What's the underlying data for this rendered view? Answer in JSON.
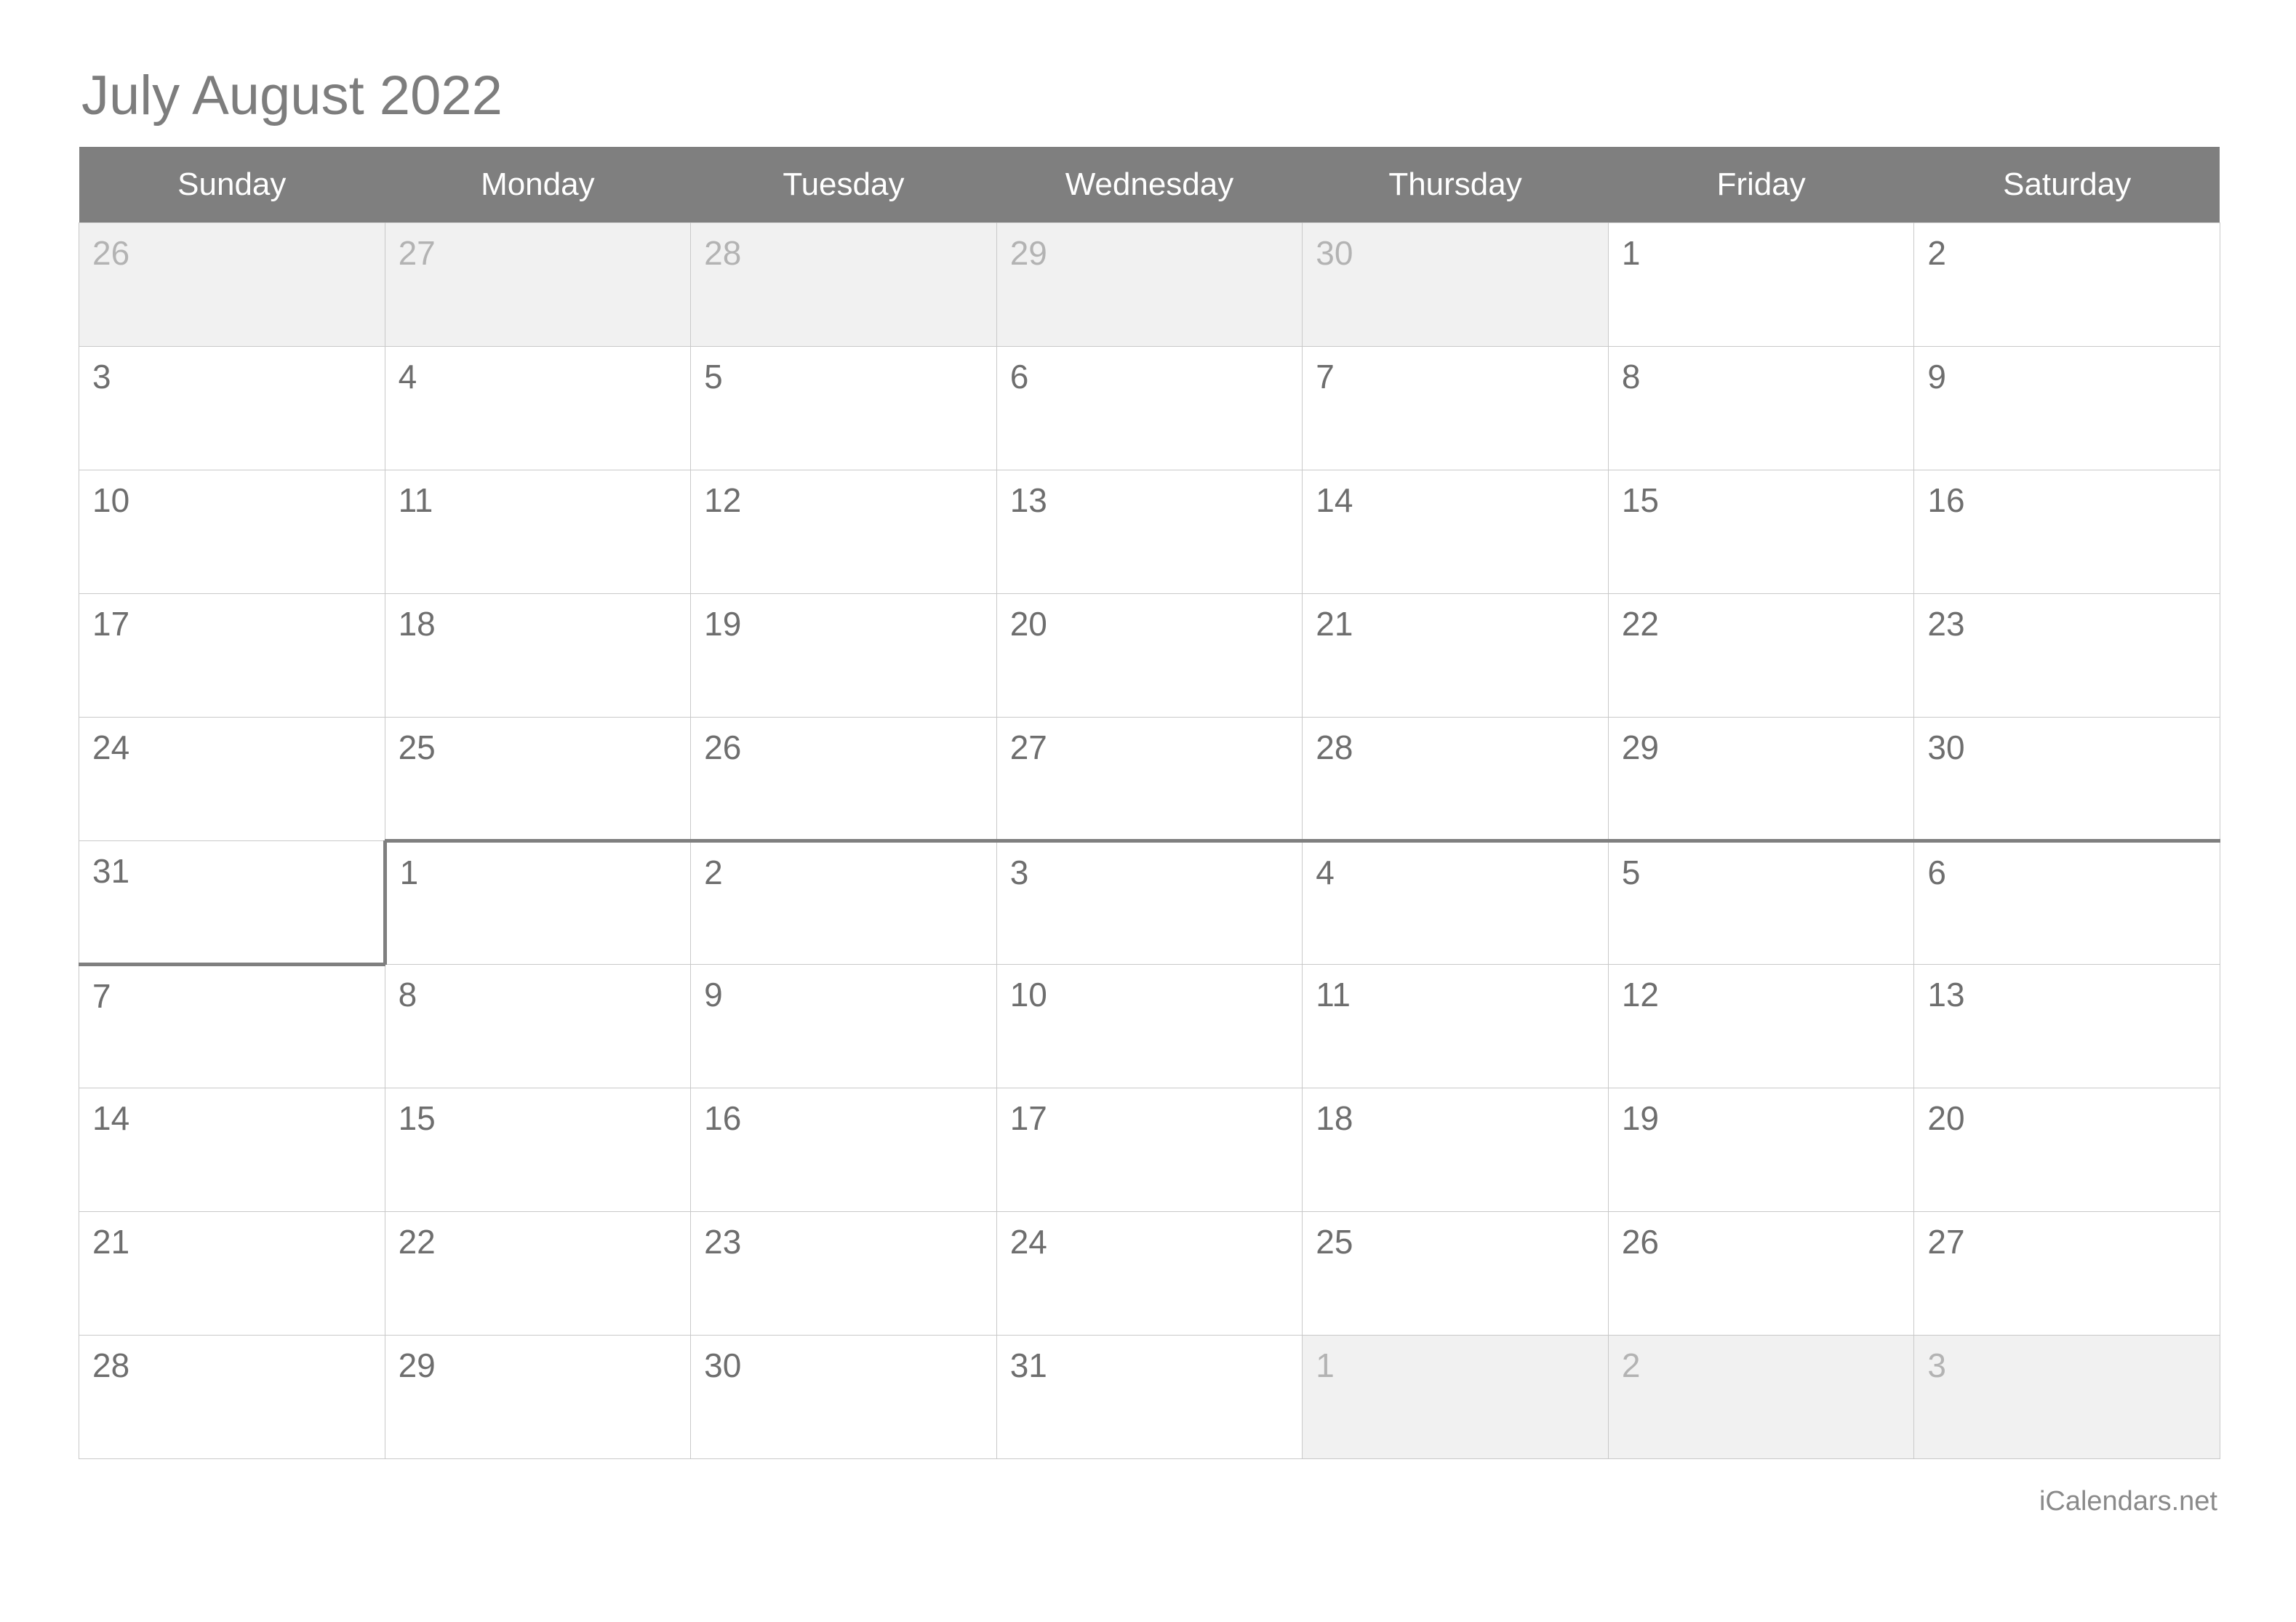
{
  "title": "July August 2022",
  "brand": "iCalendars.net",
  "colors": {
    "header_bg": "#7f7f7f",
    "header_text": "#ffffff",
    "title_text": "#7d7d7d",
    "day_text": "#6e6e6e",
    "muted_text": "#b3b3b3",
    "muted_bg": "#f1f1f1",
    "grid_line": "#c9c9c9",
    "month_divider": "#7f7f7f",
    "cell_bg": "#ffffff"
  },
  "weekdays": [
    {
      "label": "Sunday"
    },
    {
      "label": "Monday"
    },
    {
      "label": "Tuesday"
    },
    {
      "label": "Wednesday"
    },
    {
      "label": "Thursday"
    },
    {
      "label": "Friday"
    },
    {
      "label": "Saturday"
    }
  ],
  "weeks": [
    {
      "cells": [
        {
          "num": "26",
          "muted": true
        },
        {
          "num": "27",
          "muted": true
        },
        {
          "num": "28",
          "muted": true
        },
        {
          "num": "29",
          "muted": true
        },
        {
          "num": "30",
          "muted": true
        },
        {
          "num": "1",
          "muted": false
        },
        {
          "num": "2",
          "muted": false
        }
      ]
    },
    {
      "cells": [
        {
          "num": "3",
          "muted": false
        },
        {
          "num": "4",
          "muted": false
        },
        {
          "num": "5",
          "muted": false
        },
        {
          "num": "6",
          "muted": false
        },
        {
          "num": "7",
          "muted": false
        },
        {
          "num": "8",
          "muted": false
        },
        {
          "num": "9",
          "muted": false
        }
      ]
    },
    {
      "cells": [
        {
          "num": "10",
          "muted": false
        },
        {
          "num": "11",
          "muted": false
        },
        {
          "num": "12",
          "muted": false
        },
        {
          "num": "13",
          "muted": false
        },
        {
          "num": "14",
          "muted": false
        },
        {
          "num": "15",
          "muted": false
        },
        {
          "num": "16",
          "muted": false
        }
      ]
    },
    {
      "cells": [
        {
          "num": "17",
          "muted": false
        },
        {
          "num": "18",
          "muted": false
        },
        {
          "num": "19",
          "muted": false
        },
        {
          "num": "20",
          "muted": false
        },
        {
          "num": "21",
          "muted": false
        },
        {
          "num": "22",
          "muted": false
        },
        {
          "num": "23",
          "muted": false
        }
      ]
    },
    {
      "cells": [
        {
          "num": "24",
          "muted": false
        },
        {
          "num": "25",
          "muted": false
        },
        {
          "num": "26",
          "muted": false
        },
        {
          "num": "27",
          "muted": false
        },
        {
          "num": "28",
          "muted": false
        },
        {
          "num": "29",
          "muted": false
        },
        {
          "num": "30",
          "muted": false
        }
      ]
    },
    {
      "cells": [
        {
          "num": "31",
          "muted": false,
          "sep_bottom": true,
          "sep_right": true
        },
        {
          "num": "1",
          "muted": false,
          "sep_top": true
        },
        {
          "num": "2",
          "muted": false,
          "sep_top": true
        },
        {
          "num": "3",
          "muted": false,
          "sep_top": true
        },
        {
          "num": "4",
          "muted": false,
          "sep_top": true
        },
        {
          "num": "5",
          "muted": false,
          "sep_top": true
        },
        {
          "num": "6",
          "muted": false,
          "sep_top": true
        }
      ]
    },
    {
      "cells": [
        {
          "num": "7",
          "muted": false
        },
        {
          "num": "8",
          "muted": false
        },
        {
          "num": "9",
          "muted": false
        },
        {
          "num": "10",
          "muted": false
        },
        {
          "num": "11",
          "muted": false
        },
        {
          "num": "12",
          "muted": false
        },
        {
          "num": "13",
          "muted": false
        }
      ]
    },
    {
      "cells": [
        {
          "num": "14",
          "muted": false
        },
        {
          "num": "15",
          "muted": false
        },
        {
          "num": "16",
          "muted": false
        },
        {
          "num": "17",
          "muted": false
        },
        {
          "num": "18",
          "muted": false
        },
        {
          "num": "19",
          "muted": false
        },
        {
          "num": "20",
          "muted": false
        }
      ]
    },
    {
      "cells": [
        {
          "num": "21",
          "muted": false
        },
        {
          "num": "22",
          "muted": false
        },
        {
          "num": "23",
          "muted": false
        },
        {
          "num": "24",
          "muted": false
        },
        {
          "num": "25",
          "muted": false
        },
        {
          "num": "26",
          "muted": false
        },
        {
          "num": "27",
          "muted": false
        }
      ]
    },
    {
      "cells": [
        {
          "num": "28",
          "muted": false
        },
        {
          "num": "29",
          "muted": false
        },
        {
          "num": "30",
          "muted": false
        },
        {
          "num": "31",
          "muted": false
        },
        {
          "num": "1",
          "muted": true
        },
        {
          "num": "2",
          "muted": true
        },
        {
          "num": "3",
          "muted": true
        }
      ]
    }
  ]
}
